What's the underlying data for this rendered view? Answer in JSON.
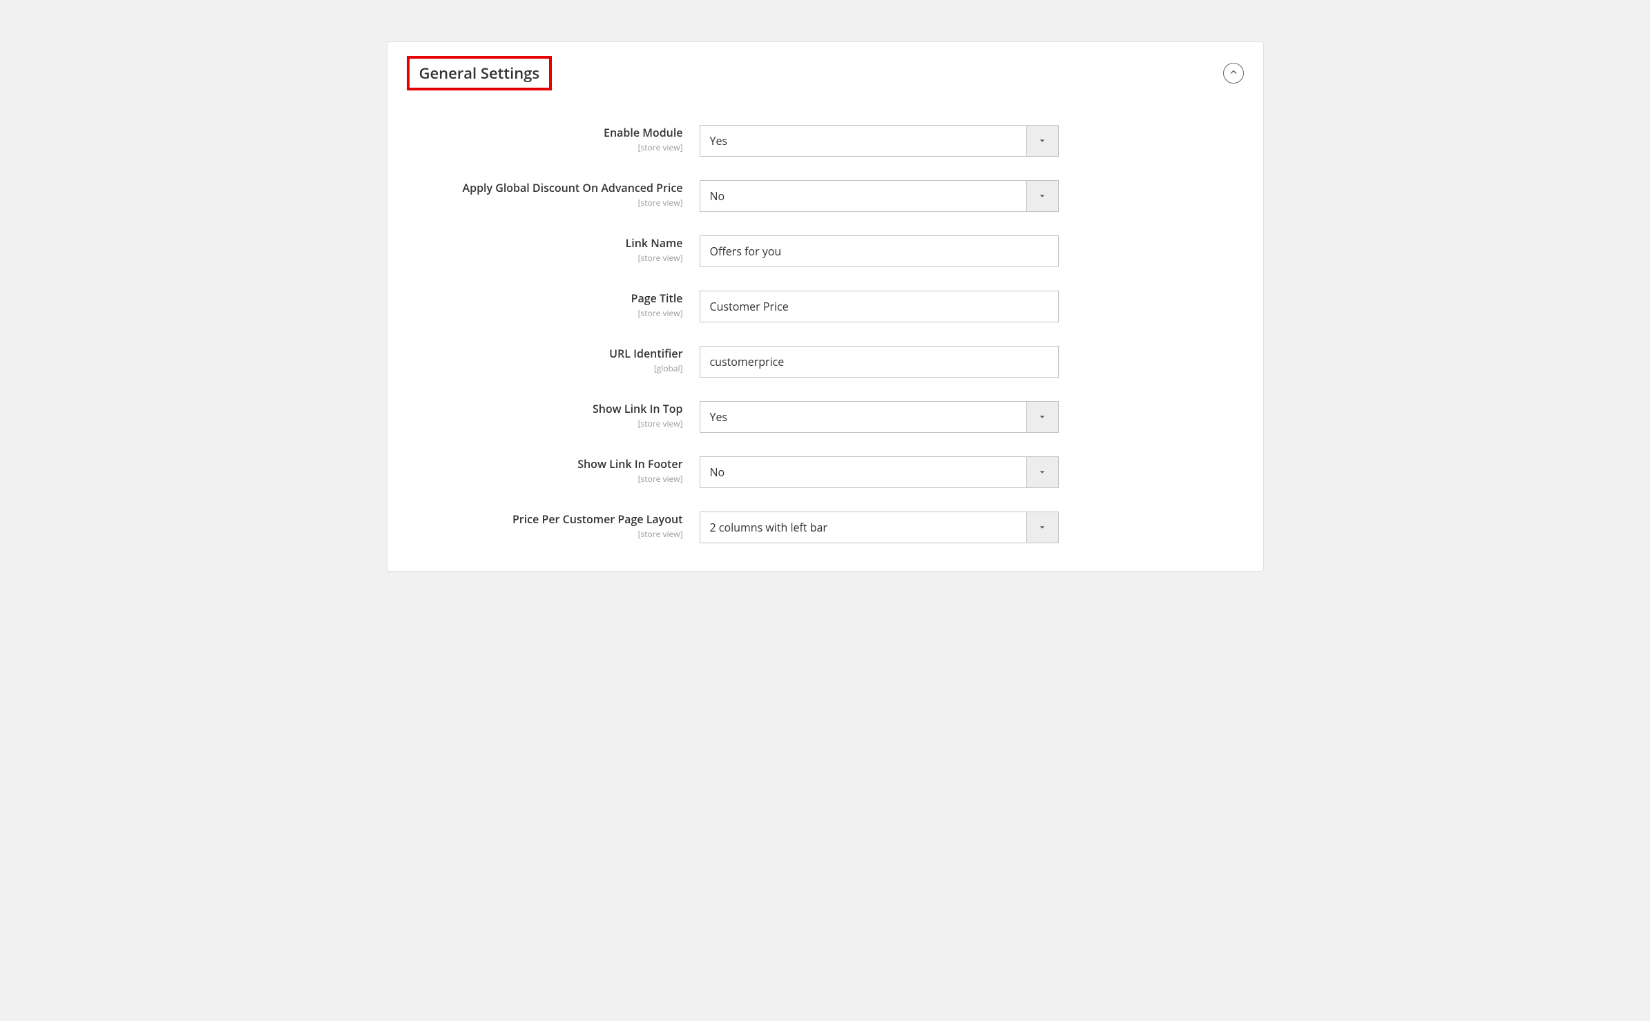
{
  "section": {
    "title": "General Settings"
  },
  "scopes": {
    "store_view": "[store view]",
    "global": "[global]"
  },
  "fields": {
    "enable_module": {
      "label": "Enable Module",
      "value": "Yes"
    },
    "apply_global_discount": {
      "label": "Apply Global Discount On Advanced Price",
      "value": "No"
    },
    "link_name": {
      "label": "Link Name",
      "value": "Offers for you"
    },
    "page_title": {
      "label": "Page Title",
      "value": "Customer Price"
    },
    "url_identifier": {
      "label": "URL Identifier",
      "value": "customerprice"
    },
    "show_link_top": {
      "label": "Show Link In Top",
      "value": "Yes"
    },
    "show_link_footer": {
      "label": "Show Link In Footer",
      "value": "No"
    },
    "page_layout": {
      "label": "Price Per Customer Page Layout",
      "value": "2 columns with left bar"
    }
  }
}
